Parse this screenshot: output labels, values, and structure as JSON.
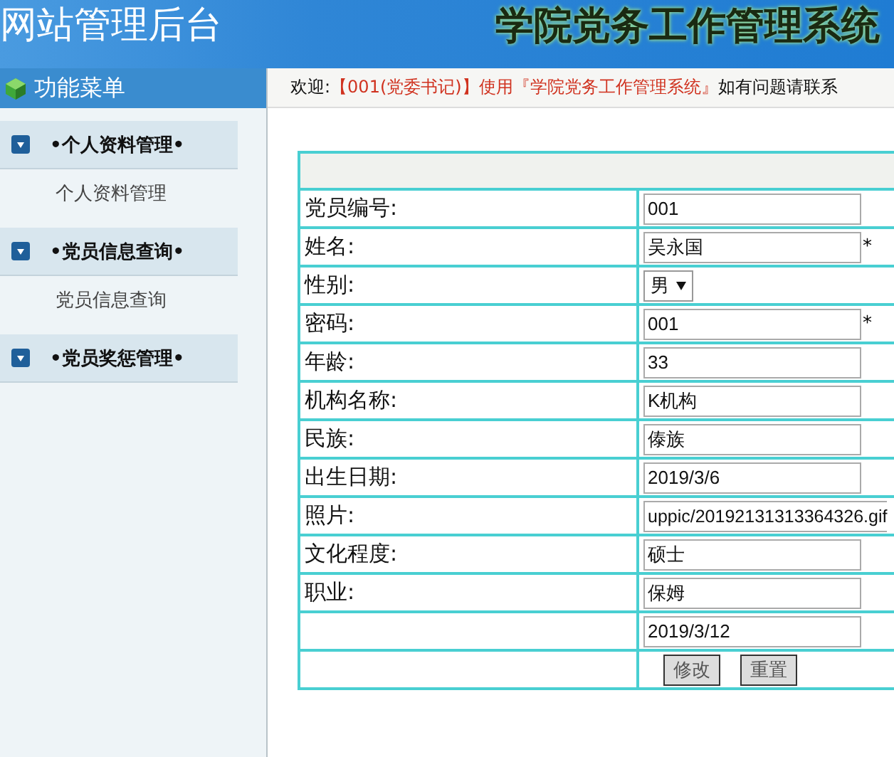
{
  "header": {
    "site_title": "网站管理后台",
    "system_title": "学院党务工作管理系统"
  },
  "sidebar": {
    "title": "功能菜单",
    "groups": [
      {
        "label": "•个人资料管理•",
        "items": [
          "个人资料管理"
        ]
      },
      {
        "label": "•党员信息查询•",
        "items": [
          "党员信息查询"
        ]
      },
      {
        "label": "•党员奖惩管理•"
      }
    ]
  },
  "welcome": [
    {
      "kind": "plain",
      "text": "欢迎:"
    },
    {
      "kind": "highlight",
      "text": "【001(党委书记)】使用『学院党务工作管理系统』"
    },
    {
      "kind": "plain",
      "text": "如有问题请联系"
    }
  ],
  "fields": [
    {
      "label": "党员编号:",
      "kind": "text",
      "value": "001"
    },
    {
      "label": "姓名:",
      "kind": "text",
      "value": "吴永国",
      "note": "*"
    },
    {
      "label": "性别:",
      "kind": "select",
      "value": "男"
    },
    {
      "label": "密码:",
      "kind": "text",
      "value": "001",
      "note": "*"
    },
    {
      "label": "年龄:",
      "kind": "text",
      "value": "33"
    },
    {
      "label": "机构名称:",
      "kind": "text",
      "value": "K机构"
    },
    {
      "label": "民族:",
      "kind": "text",
      "value": "傣族"
    },
    {
      "label": "出生日期:",
      "kind": "text",
      "value": "2019/3/6"
    },
    {
      "label": "照片:",
      "kind": "wide",
      "value": "uppic/20192131313364326.gif"
    },
    {
      "label": "文化程度:",
      "kind": "text",
      "value": "硕士"
    },
    {
      "label": "职业:",
      "kind": "text",
      "value": "保姆"
    },
    {
      "kind": "text",
      "value": "2019/3/12"
    }
  ],
  "buttons": [
    "修改",
    "重置"
  ]
}
